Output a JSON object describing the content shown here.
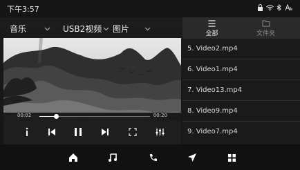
{
  "status_bar": {
    "time": "下午3:57"
  },
  "source_tabs": {
    "music": "音乐",
    "usb_video": "USB2视频",
    "picture": "图片"
  },
  "player": {
    "elapsed": "00:02",
    "duration": "00:20",
    "progress": 0.15
  },
  "browser": {
    "tab_all": "全部",
    "tab_folder": "文件夹"
  },
  "playlist": [
    "5. Video2.mp4",
    "6. Video1.mp4",
    "7. Video13.mp4",
    "8. Video9.mp4",
    "9. Video7.mp4"
  ],
  "icons": {
    "info": "info-icon",
    "previous": "previous-icon",
    "pause": "pause-icon",
    "next": "next-icon",
    "fullscreen": "fullscreen-icon",
    "equalizer": "equalizer-icon",
    "home": "home-icon",
    "music": "music-note-icon",
    "phone": "phone-icon",
    "navigation": "navigation-icon",
    "apps": "apps-icon"
  },
  "colors": {
    "background": "#171717",
    "accent": "#ffffff",
    "text": "#dcdcdc"
  }
}
